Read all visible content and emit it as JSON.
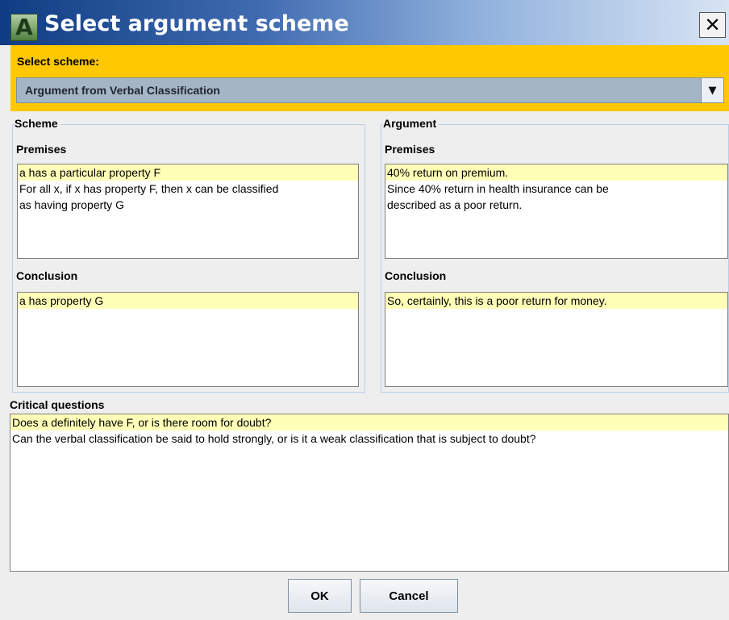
{
  "window": {
    "title": "Select argument scheme",
    "icon_letter": "A"
  },
  "scheme_select": {
    "label": "Select scheme:",
    "value": "Argument from Verbal Classification",
    "colors": {
      "bar": "#ffc800",
      "combo": "#a4b6c6"
    }
  },
  "scheme": {
    "group_title": "Scheme",
    "premises_label": "Premises",
    "premises": [
      "a has a particular property F",
      " For all x, if x has property F, then x can be classified",
      "as having property G"
    ],
    "conclusion_label": "Conclusion",
    "conclusion": [
      "a has property G"
    ]
  },
  "argument": {
    "group_title": "Argument",
    "premises_label": "Premises",
    "premises": [
      "40% return on premium.",
      "Since 40% return in health insurance can be",
      "described as a poor return."
    ],
    "conclusion_label": "Conclusion",
    "conclusion": [
      "So, certainly, this is a poor return for money."
    ]
  },
  "critical_questions": {
    "label": "Critical questions",
    "items": [
      "Does a definitely have F, or is there room for doubt?",
      "Can the verbal classification be said to hold strongly, or is it a weak classification that is subject to doubt?"
    ]
  },
  "buttons": {
    "ok": "OK",
    "cancel": "Cancel"
  },
  "highlight_color": "#ffffb8"
}
